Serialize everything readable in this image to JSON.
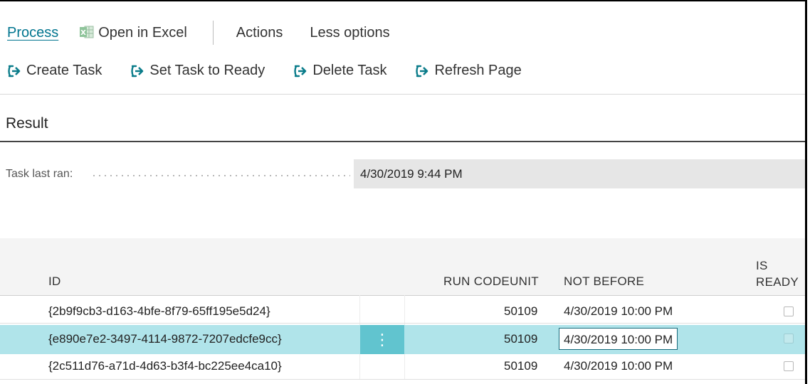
{
  "tabs": [
    {
      "label": "Process"
    },
    {
      "label": "Open in Excel"
    },
    {
      "label": "Actions"
    },
    {
      "label": "Less options"
    }
  ],
  "actions": [
    {
      "label": "Create Task",
      "icon": "arrow-right-icon"
    },
    {
      "label": "Set Task to Ready",
      "icon": "arrow-right-icon"
    },
    {
      "label": "Delete Task",
      "icon": "arrow-right-icon"
    },
    {
      "label": "Refresh Page",
      "icon": "arrow-right-icon"
    }
  ],
  "section": {
    "title": "Result"
  },
  "field": {
    "label": "Task last ran:",
    "value": "4/30/2019 9:44 PM"
  },
  "grid": {
    "headers": {
      "id": "ID",
      "run_codeunit": "RUN CODEUNIT",
      "not_before": "NOT BEFORE",
      "is_ready_1": "IS",
      "is_ready_2": "READY"
    },
    "rows": [
      {
        "id": "{2b9f9cb3-d163-4bfe-8f79-65ff195e5d24}",
        "run_codeunit": "50109",
        "not_before": "4/30/2019 10:00 PM",
        "is_ready": false
      },
      {
        "id": "{e890e7e2-3497-4114-9872-7207edcfe9cc}",
        "run_codeunit": "50109",
        "not_before": "4/30/2019 10:00 PM",
        "is_ready": false,
        "selected": true
      },
      {
        "id": "{2c511d76-a71d-4d63-b3f4-bc225ee4ca10}",
        "run_codeunit": "50109",
        "not_before": "4/30/2019 10:00 PM",
        "is_ready": false
      }
    ]
  },
  "colors": {
    "accent": "#00758f",
    "selected_row": "#b0e4ea",
    "kebab": "#61c4cf",
    "excel_green": "#1e7145"
  }
}
